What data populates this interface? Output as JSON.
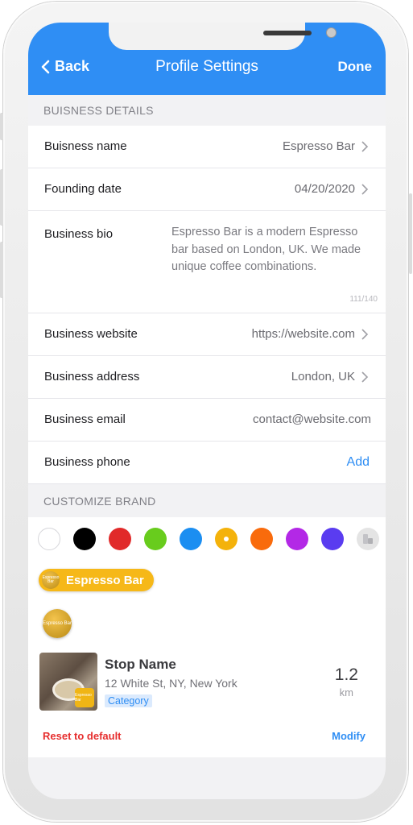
{
  "nav": {
    "back_label": "Back",
    "title": "Profile Settings",
    "done_label": "Done"
  },
  "sections": {
    "business_details": "BUISNESS DETAILS",
    "customize_brand": "CUSTOMIZE BRAND"
  },
  "rows": {
    "name": {
      "label": "Buisness name",
      "value": "Espresso Bar"
    },
    "founding": {
      "label": "Founding date",
      "value": "04/20/2020"
    },
    "bio": {
      "label": "Business bio",
      "value": "Espresso Bar is a modern Espresso bar based on London, UK. We made unique coffee combinations.",
      "count": "111/140"
    },
    "website": {
      "label": "Business website",
      "value": "https://website.com"
    },
    "address": {
      "label": "Business address",
      "value": "London, UK"
    },
    "email": {
      "label": "Business email",
      "value": "contact@website.com"
    },
    "phone": {
      "label": "Business phone",
      "action": "Add"
    }
  },
  "brand_colors": [
    {
      "name": "white",
      "hex": "#ffffff"
    },
    {
      "name": "black",
      "hex": "#000000"
    },
    {
      "name": "red",
      "hex": "#e12a2a"
    },
    {
      "name": "green",
      "hex": "#68cc1d"
    },
    {
      "name": "blue",
      "hex": "#1b8ef1"
    },
    {
      "name": "yellow",
      "hex": "#f4b20b",
      "selected": true
    },
    {
      "name": "orange",
      "hex": "#f96b0c"
    },
    {
      "name": "purple",
      "hex": "#b328e6"
    },
    {
      "name": "indigo",
      "hex": "#5a3cf0"
    },
    {
      "name": "custom-picker",
      "hex": "#e4e4e4"
    }
  ],
  "preview": {
    "pill_label": "Espresso Bar",
    "logo_text": "Espresso Bar",
    "stop_name": "Stop Name",
    "stop_address": "12 White St, NY, New York",
    "category": "Category",
    "distance": "1.2",
    "distance_unit": "km"
  },
  "footer": {
    "reset_label": "Reset to default",
    "modify_label": "Modify"
  },
  "theme": {
    "accent": "#2f8ef4",
    "danger": "#e62e2e"
  }
}
